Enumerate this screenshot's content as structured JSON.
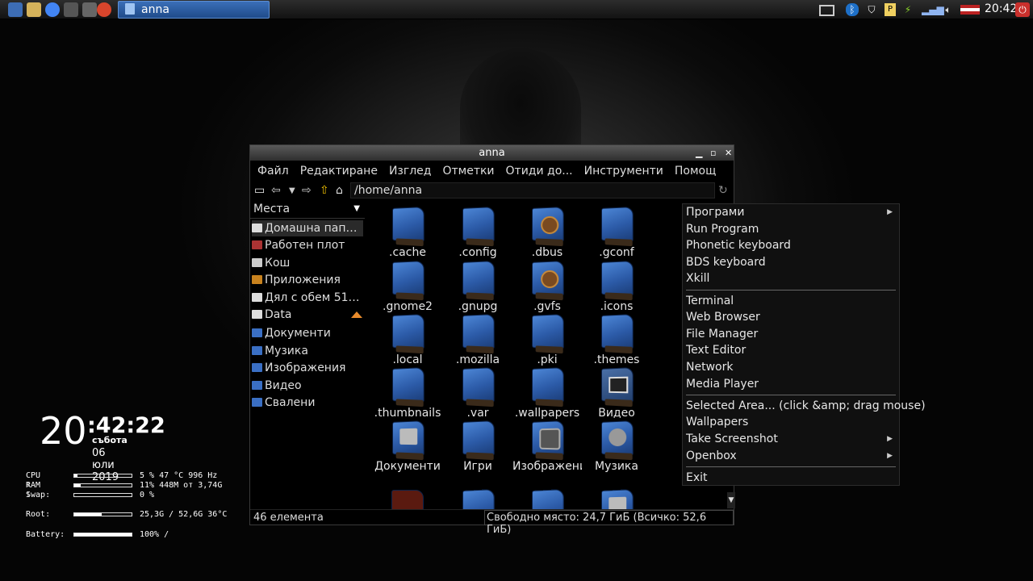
{
  "colors": {
    "panel": "#1c1c1c",
    "task_active": "#2f63aa",
    "menu_bg": "#101010",
    "folder_blue": "#3a6fc4"
  },
  "panel": {
    "launchers": [
      "file-manager-icon",
      "files-icon",
      "chrome-icon",
      "terminal-icon",
      "media-icon",
      "firefox-icon"
    ],
    "task_title": "anna",
    "tray_icons": [
      "window-list-icon",
      "bluetooth-icon",
      "shield-icon",
      "clipboard-icon",
      "battery-charging-icon",
      "network-signal-icon",
      "volume-icon",
      "keyboard-flag-icon"
    ],
    "clock": "20:42"
  },
  "file_manager": {
    "title": "anna",
    "menu": [
      "Файл",
      "Редактиране",
      "Изглед",
      "Отметки",
      "Отиди до...",
      "Инструменти",
      "Помощ"
    ],
    "path": "/home/anna",
    "places_header": "Места",
    "places": [
      {
        "label": "Домашна пап…",
        "icon": "home-icon"
      },
      {
        "label": "Работен плот",
        "icon": "desktop-icon"
      },
      {
        "label": "Кош",
        "icon": "trash-icon"
      },
      {
        "label": "Приложения",
        "icon": "apps-icon"
      },
      {
        "label": "Дял с обем 51…",
        "icon": "drive-icon"
      },
      {
        "label": "Data",
        "icon": "drive-icon"
      },
      {
        "label": "Документи",
        "icon": "folder-icon"
      },
      {
        "label": "Музика",
        "icon": "folder-icon"
      },
      {
        "label": "Изображения",
        "icon": "folder-icon"
      },
      {
        "label": "Видео",
        "icon": "folder-icon"
      },
      {
        "label": "Свалени",
        "icon": "folder-icon"
      }
    ],
    "items": [
      {
        "name": ".cache",
        "kind": "folder"
      },
      {
        "name": ".config",
        "kind": "folder"
      },
      {
        "name": ".dbus",
        "kind": "lock"
      },
      {
        "name": ".gconf",
        "kind": "folder"
      },
      {
        "name": ".gnome2",
        "kind": "folder"
      },
      {
        "name": ".gnupg",
        "kind": "folder"
      },
      {
        "name": ".gvfs",
        "kind": "lock"
      },
      {
        "name": ".icons",
        "kind": "folder"
      },
      {
        "name": ".local",
        "kind": "folder"
      },
      {
        "name": ".mozilla",
        "kind": "folder"
      },
      {
        "name": ".pki",
        "kind": "folder"
      },
      {
        "name": ".themes",
        "kind": "folder"
      },
      {
        "name": ".thumbnails",
        "kind": "folder"
      },
      {
        "name": ".var",
        "kind": "folder"
      },
      {
        "name": ".wallpapers",
        "kind": "folder"
      },
      {
        "name": "Видео",
        "kind": "film"
      },
      {
        "name": "Документи",
        "kind": "doc"
      },
      {
        "name": "Игри",
        "kind": "folder"
      },
      {
        "name": "Изображения",
        "kind": "img"
      },
      {
        "name": "Музика",
        "kind": "mus"
      }
    ],
    "status_count": "46 елемента",
    "status_free": "Свободно място: 24,7 ГиБ (Всичко: 52,6 ГиБ)"
  },
  "context_menu": {
    "groups": [
      [
        {
          "label": "Програми",
          "submenu": true
        },
        {
          "label": "Run Program"
        },
        {
          "label": "Phonetic keyboard"
        },
        {
          "label": "BDS keyboard"
        },
        {
          "label": "Xkill"
        }
      ],
      [
        {
          "label": "Terminal"
        },
        {
          "label": "Web Browser"
        },
        {
          "label": "File Manager"
        },
        {
          "label": "Text Editor"
        },
        {
          "label": "Network"
        },
        {
          "label": "Media Player"
        }
      ],
      [
        {
          "label": "Selected Area... (click &amp; drag mouse)"
        },
        {
          "label": "Wallpapers"
        },
        {
          "label": "Take Screenshot",
          "submenu": true
        },
        {
          "label": "Openbox",
          "submenu": true
        }
      ],
      [
        {
          "label": "Exit"
        }
      ]
    ]
  },
  "conky": {
    "hour": "20",
    "minutes": ":42:22",
    "weekday": "събота",
    "date": "06 юли 2019",
    "rows": [
      {
        "label": "CPU :",
        "pct": 5,
        "value": "5 %  47 °C 996 Hz"
      },
      {
        "label": "RAM :",
        "pct": 11,
        "value": "11% 448M  от 3,74G"
      },
      {
        "label": "Swap:",
        "pct": 0,
        "value": "0 %"
      },
      {
        "label": "Root:",
        "pct": 48,
        "value": "25,3G / 52,6G 36°C"
      },
      {
        "label": "Battery:",
        "pct": 100,
        "value": "100% /"
      }
    ]
  }
}
